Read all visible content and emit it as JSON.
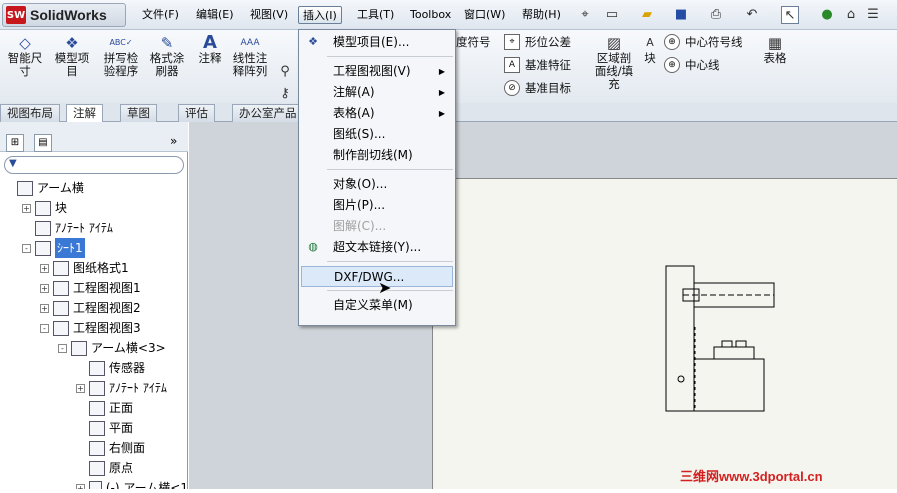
{
  "app": {
    "name": "SolidWorks",
    "logo_badge": "SW"
  },
  "menus": [
    "文件(F)",
    "编辑(E)",
    "视图(V)",
    "插入(I)",
    "工具(T)",
    "Toolbox",
    "窗口(W)",
    "帮助(H)"
  ],
  "ribbon": {
    "smart_dim": "智能尺\n寸",
    "model_items": "模型项\n目",
    "spell": "拼写检\n验程序",
    "format_painter": "格式涂\n刷器",
    "note": "注释",
    "linear_note": "线性注\n释阵列",
    "surface_finish": "度符号",
    "geo_tol": "形位公差",
    "datum_feature": "基准特征",
    "datum_target": "基准目标",
    "area_hatch": "区域剖\n面线/填\n充",
    "block": "块",
    "center_mark": "中心符号线",
    "centerline": "中心线",
    "table": "表格"
  },
  "tabs": [
    "视图布局",
    "注解",
    "草图",
    "评估",
    "办公室产品"
  ],
  "tree": [
    {
      "label": "アーム横",
      "indent": 0,
      "exp": ""
    },
    {
      "label": "块",
      "indent": 1,
      "exp": "+"
    },
    {
      "label": "ｱﾉﾃｰﾄ ｱｲﾃﾑ",
      "indent": 1,
      "exp": ""
    },
    {
      "label": "ｼｰﾄ1",
      "indent": 1,
      "exp": "-"
    },
    {
      "label": "图纸格式1",
      "indent": 2,
      "exp": "+"
    },
    {
      "label": "工程图视图1",
      "indent": 2,
      "exp": "+"
    },
    {
      "label": "工程图视图2",
      "indent": 2,
      "exp": "+"
    },
    {
      "label": "工程图视图3",
      "indent": 2,
      "exp": "-"
    },
    {
      "label": "アーム横<3>",
      "indent": 3,
      "exp": "-"
    },
    {
      "label": "传感器",
      "indent": 4,
      "exp": ""
    },
    {
      "label": "ｱﾉﾃｰﾄ ｱｲﾃﾑ",
      "indent": 4,
      "exp": "+"
    },
    {
      "label": "正面",
      "indent": 4,
      "exp": ""
    },
    {
      "label": "平面",
      "indent": 4,
      "exp": ""
    },
    {
      "label": "右侧面",
      "indent": 4,
      "exp": ""
    },
    {
      "label": "原点",
      "indent": 4,
      "exp": ""
    },
    {
      "label": "(-) アーム横<1",
      "indent": 4,
      "exp": "+"
    }
  ],
  "insert_menu": [
    {
      "label": "模型项目(E)...",
      "type": "item",
      "icon": "model-items-icon"
    },
    {
      "type": "sep"
    },
    {
      "label": "工程图视图(V)",
      "type": "item",
      "sub": true
    },
    {
      "label": "注解(A)",
      "type": "item",
      "sub": true
    },
    {
      "label": "表格(A)",
      "type": "item",
      "sub": true
    },
    {
      "label": "图纸(S)...",
      "type": "item"
    },
    {
      "label": "制作剖切线(M)",
      "type": "item"
    },
    {
      "type": "sep"
    },
    {
      "label": "对象(O)...",
      "type": "item"
    },
    {
      "label": "图片(P)...",
      "type": "item"
    },
    {
      "label": "图解(C)...",
      "type": "item",
      "disabled": true
    },
    {
      "label": "超文本链接(Y)...",
      "type": "item",
      "icon": "globe-icon"
    },
    {
      "type": "sep"
    },
    {
      "label": "DXF/DWG...",
      "type": "item",
      "highlight": true
    },
    {
      "type": "sep"
    },
    {
      "label": "自定义菜单(M)",
      "type": "item"
    }
  ],
  "watermark": "三维网www.3dportal.cn"
}
